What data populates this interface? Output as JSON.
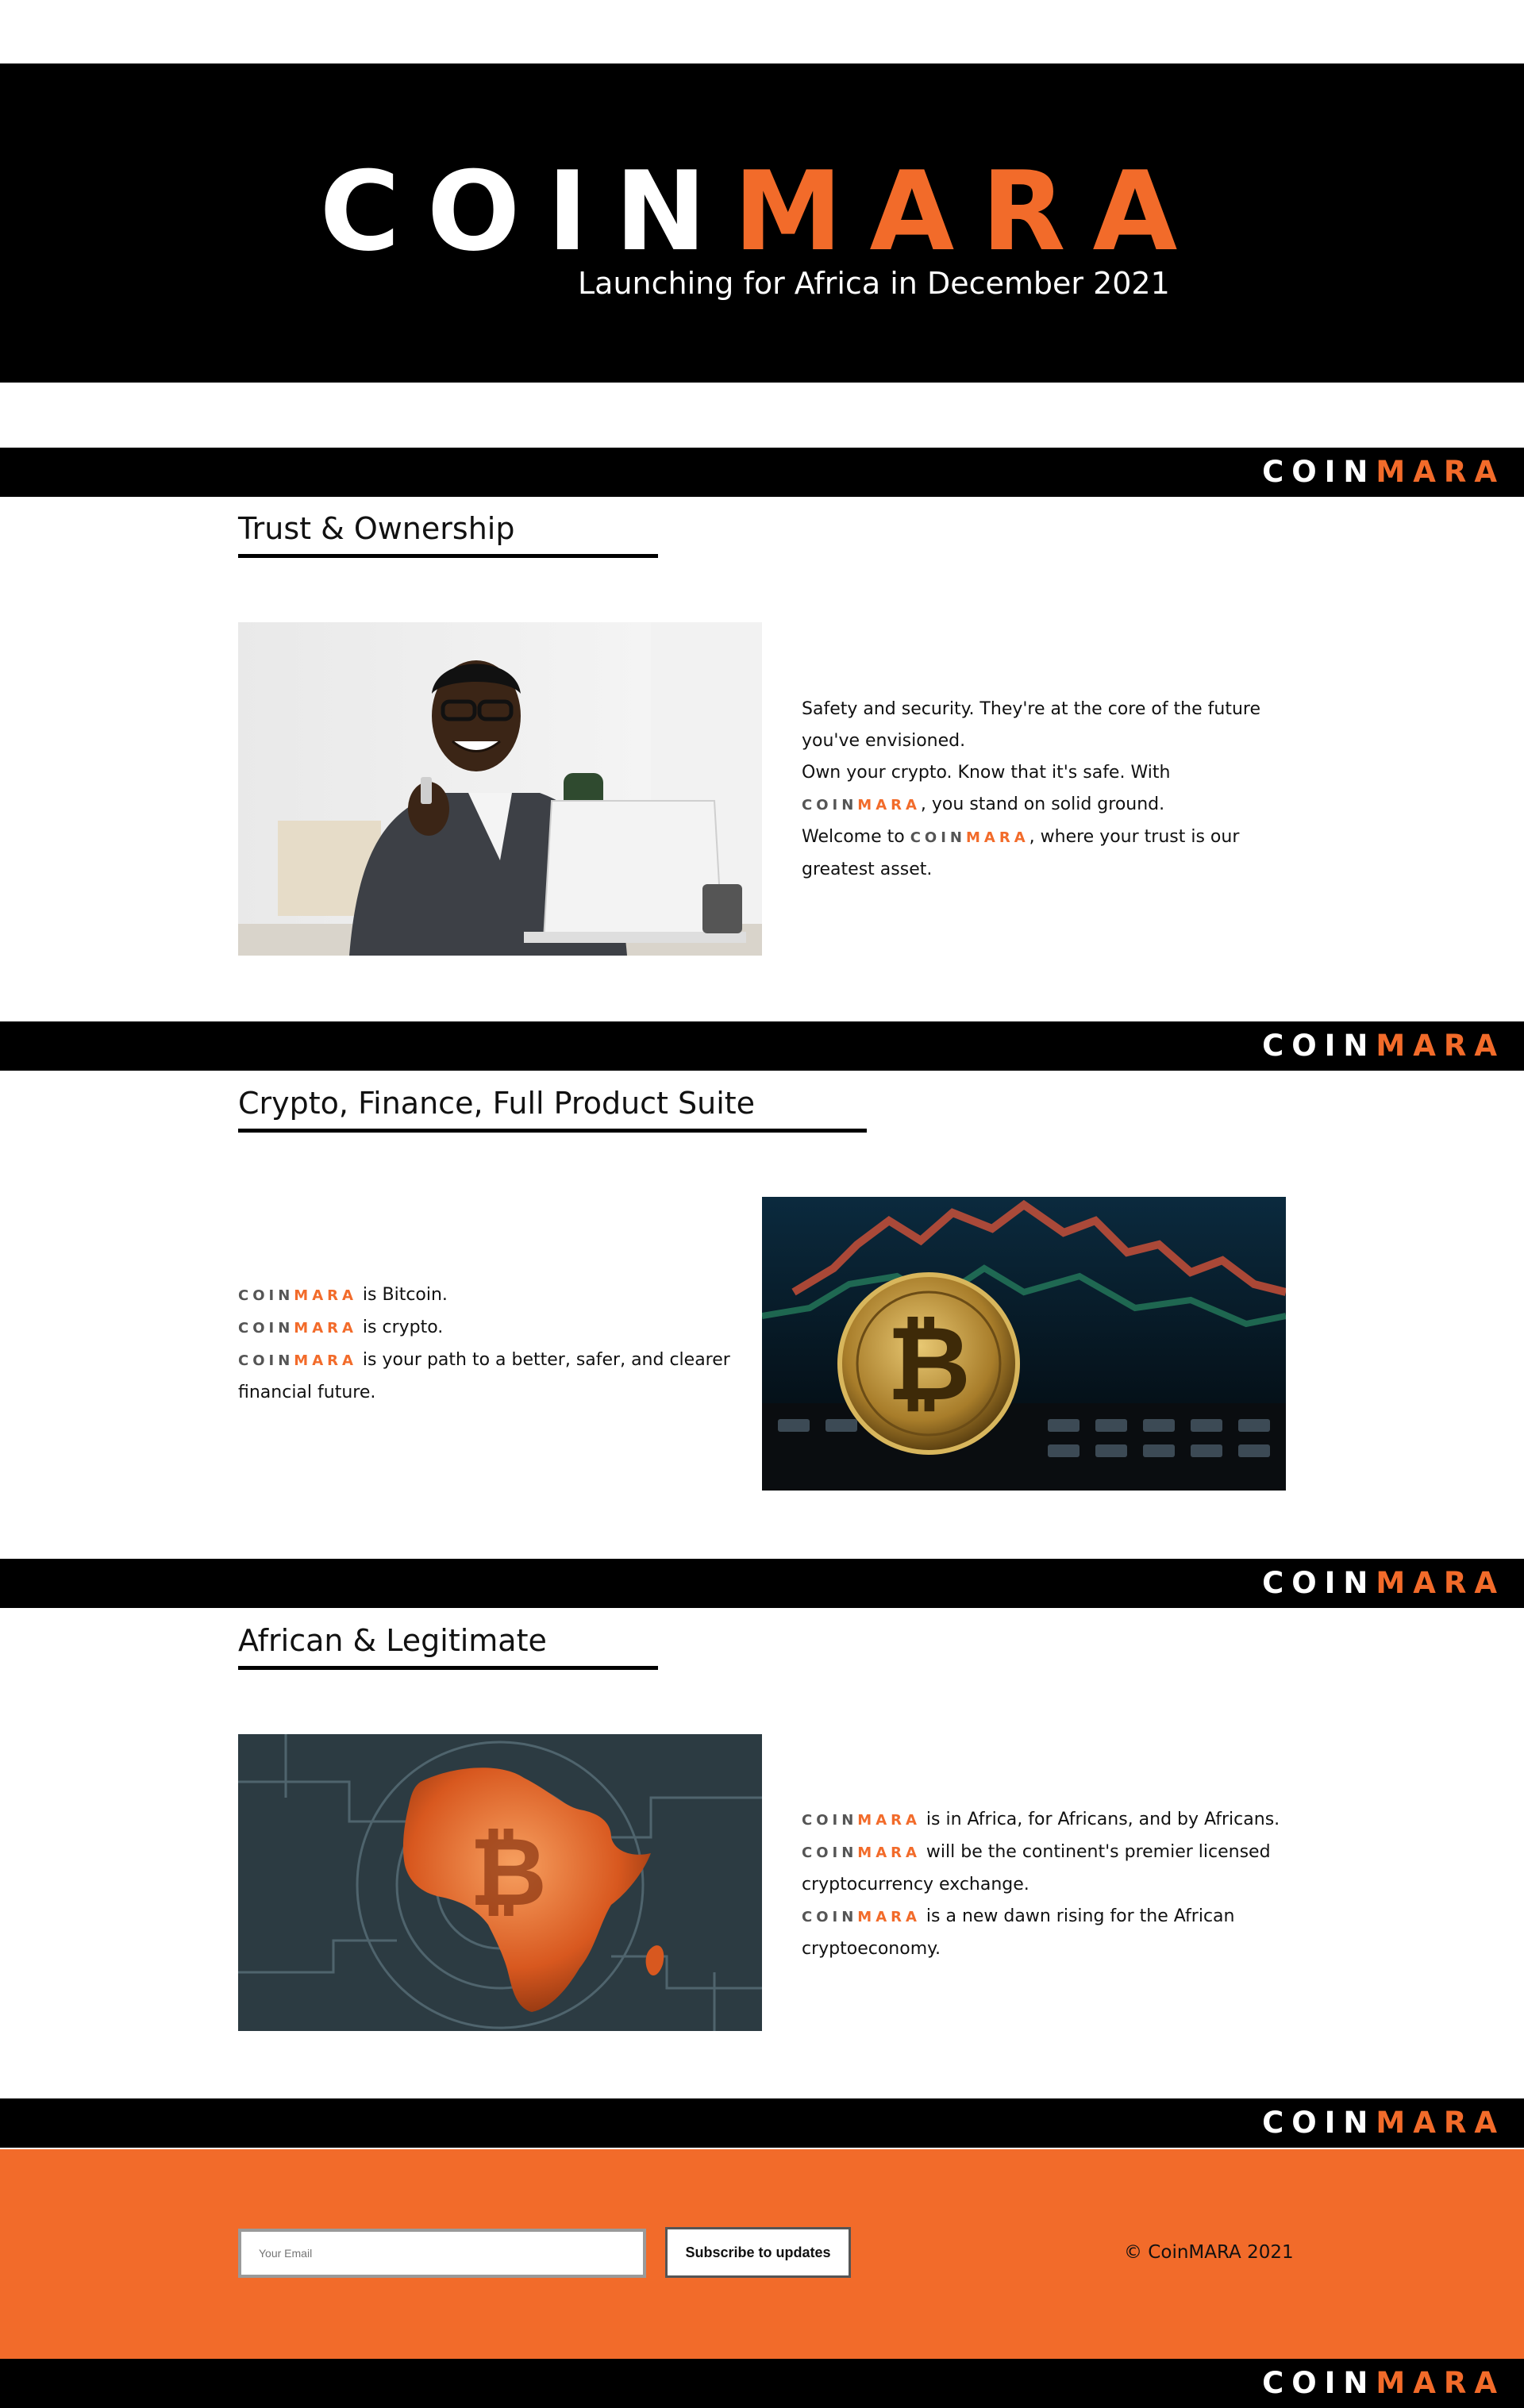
{
  "brand": {
    "coin": "COIN",
    "mara": "MARA",
    "accent_color": "#f26b2a"
  },
  "hero": {
    "tagline": "Launching for Africa in December 2021"
  },
  "sections": [
    {
      "heading": "Trust & Ownership",
      "image_alt": "Smiling man in suit talking on phone at laptop",
      "lines": {
        "l1": "Safety and security. They're at the core of the future you've envisioned.",
        "l2": "Own your crypto. Know that it's safe. With",
        "l3": ", you stand on solid ground.",
        "l4a": "Welcome to",
        "l4b": ", where your trust is our greatest asset."
      }
    },
    {
      "heading": "Crypto, Finance, Full Product Suite",
      "image_alt": "Gold bitcoin coin on keyboard with trading chart",
      "lines": {
        "l1": " is Bitcoin.",
        "l2": " is crypto.",
        "l3": " is your path to a better, safer, and clearer financial future."
      }
    },
    {
      "heading": "African & Legitimate",
      "image_alt": "Map of Africa glowing with a bitcoin symbol over circuit board",
      "lines": {
        "l1": " is in Africa, for Africans, and by Africans.",
        "l2": " will be the continent's premier licensed cryptocurrency exchange.",
        "l3": " is a new dawn rising for the African cryptoeconomy."
      }
    }
  ],
  "footer": {
    "email_placeholder": "Your Email",
    "subscribe_label": "Subscribe to updates",
    "copyright": "© CoinMARA 2021"
  }
}
